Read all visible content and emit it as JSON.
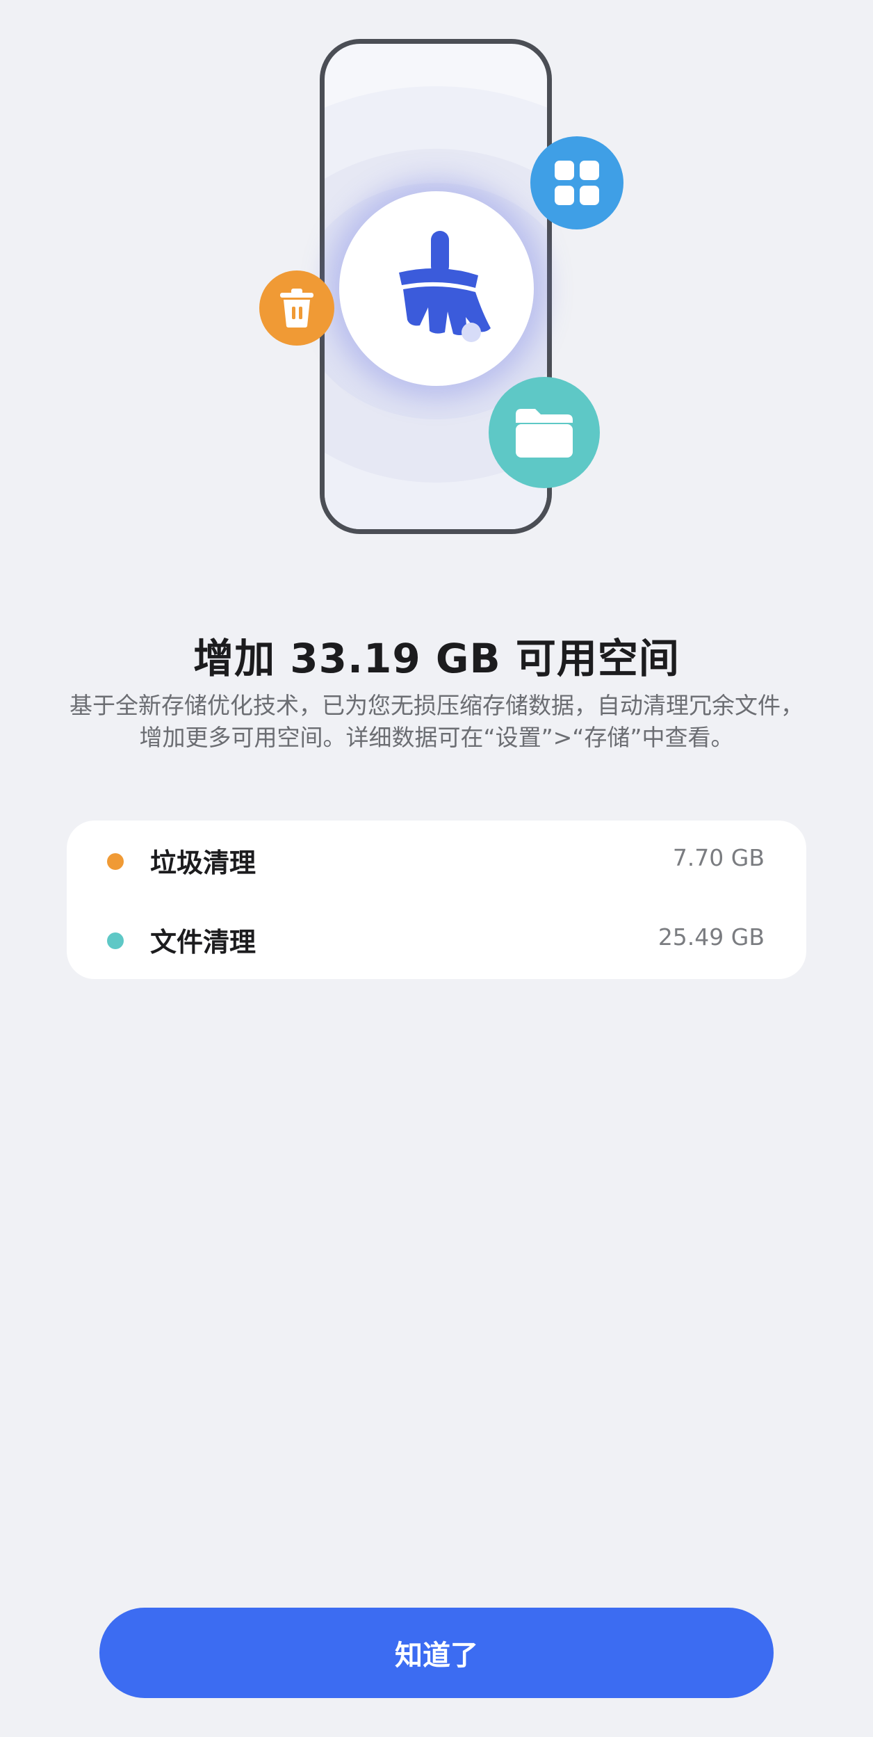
{
  "hero": {
    "icons": {
      "center": "broom-icon",
      "left": "trash-icon",
      "top_right": "apps-grid-icon",
      "bottom_right": "folder-icon"
    },
    "colors": {
      "trash": "#f09a35",
      "apps": "#3f9fe6",
      "folder": "#5ec8c6",
      "brush": "#3b5bdb"
    }
  },
  "summary": {
    "title": "增加 33.19 GB 可用空间",
    "description": "基于全新存储优化技术，已为您无损压缩存储数据，自动清理冗余文件，增加更多可用空间。详细数据可在“设置”>“存储”中查看。"
  },
  "items": [
    {
      "label": "垃圾清理",
      "value": "7.70 GB",
      "color": "#f09a35"
    },
    {
      "label": "文件清理",
      "value": "25.49 GB",
      "color": "#5ec8c6"
    }
  ],
  "actions": {
    "confirm_label": "知道了",
    "accent": "#3c6cf2"
  }
}
